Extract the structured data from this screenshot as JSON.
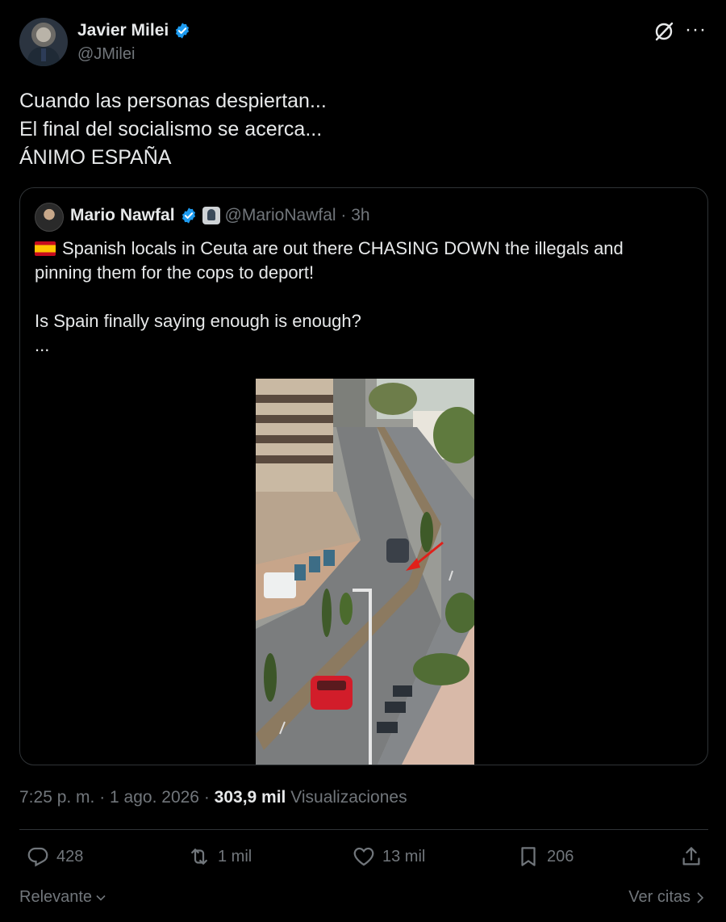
{
  "author": {
    "name": "Javier Milei",
    "handle": "@JMilei"
  },
  "tweet": {
    "lines": [
      "Cuando las personas despiertan...",
      "El final del socialismo se acerca...",
      "ÁNIMO ESPAÑA"
    ]
  },
  "quoted": {
    "name": "Mario Nawfal",
    "handle_time": "@MarioNawfal · 3h",
    "line1": "Spanish locals in Ceuta are out there CHASING DOWN the illegals and",
    "line2": "pinning them for the cops to deport!",
    "line3": "Is Spain finally saying enough is enough?",
    "line4": "..."
  },
  "meta": {
    "time_date": "7:25 p. m. · 1 ago. 2026 · ",
    "views_count": "303,9 mil",
    "views_label": " Visualizaciones"
  },
  "actions": {
    "replies": "428",
    "reposts": "1 mil",
    "likes": "13 mil",
    "bookmarks": "206"
  },
  "footer": {
    "sort_label": "Relevante",
    "quotes_link": "Ver citas"
  },
  "colors": {
    "background": "#000000",
    "text": "#e7e9ea",
    "secondary": "#71767b",
    "border": "#2f3336",
    "verified": "#1d9bf0",
    "arrow": "#e0201a"
  }
}
